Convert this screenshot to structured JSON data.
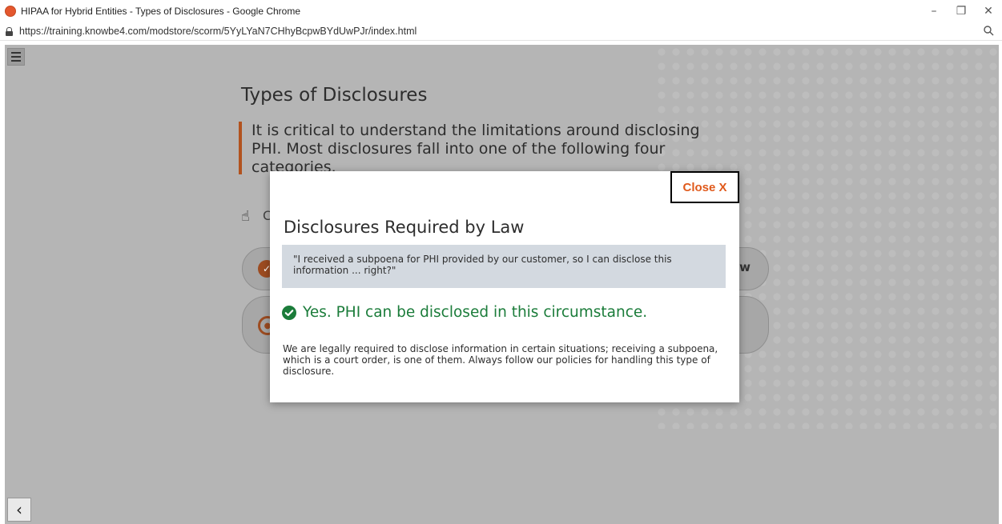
{
  "window": {
    "title": "HIPAA for Hybrid Entities - Types of Disclosures - Google Chrome",
    "minimize_glyph": "–",
    "restore_glyph": "❐",
    "close_glyph": "✕"
  },
  "address": {
    "url": "https://training.knowbe4.com/modstore/scorm/5YyLYaN7CHhyBcpwBYdUwPJr/index.html"
  },
  "page": {
    "title": "Types of Disclosures",
    "intro": "It is critical to understand the limitations around disclosing PHI. Most disclosures fall into one of the following four categories.",
    "hint_fragment": "C",
    "pill1_fragment": "w",
    "back_glyph": "‹"
  },
  "modal": {
    "close_label": "Close X",
    "title": "Disclosures Required by Law",
    "quote": "\"I received a subpoena for PHI provided by our customer, so I can disclose this information ... right?\"",
    "answer": "Yes. PHI can be disclosed in this circumstance.",
    "explanation": "We are legally required to disclose information in certain situations; receiving a subpoena, which is a court order, is one of them. Always follow our policies for handling this type of disclosure."
  },
  "colors": {
    "accent": "#e05a1c",
    "success": "#1b7c3a",
    "quote_bg": "#d3d9e0",
    "overlay": "#b5b5b5"
  }
}
